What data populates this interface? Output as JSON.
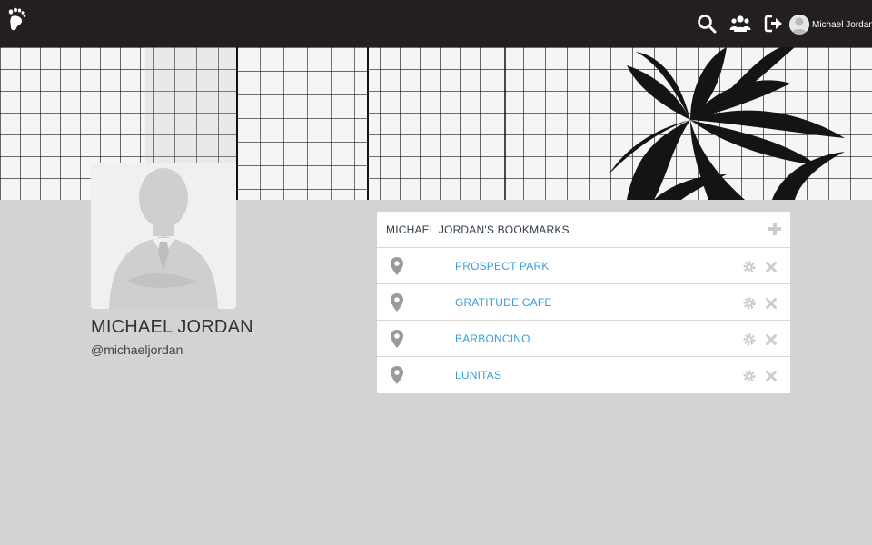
{
  "topbar": {
    "logo_icon": "footprint-icon",
    "search_icon": "search-icon",
    "users_icon": "users-icon",
    "logout_icon": "sign-out-icon",
    "user_name": "Michael Jordan"
  },
  "profile": {
    "name": "MICHAEL JORDAN",
    "handle": "@michaeljordan"
  },
  "bookmarks": {
    "title": "MICHAEL JORDAN'S BOOKMARKS",
    "items": [
      {
        "label": "PROSPECT PARK"
      },
      {
        "label": "GRATITUDE CAFE"
      },
      {
        "label": "BARBONCINO"
      },
      {
        "label": "LUNITAS"
      }
    ]
  },
  "colors": {
    "topbar": "#231f20",
    "background": "#d3d3d3",
    "link": "#3a9fd6",
    "icon_gray": "#cccccc"
  }
}
